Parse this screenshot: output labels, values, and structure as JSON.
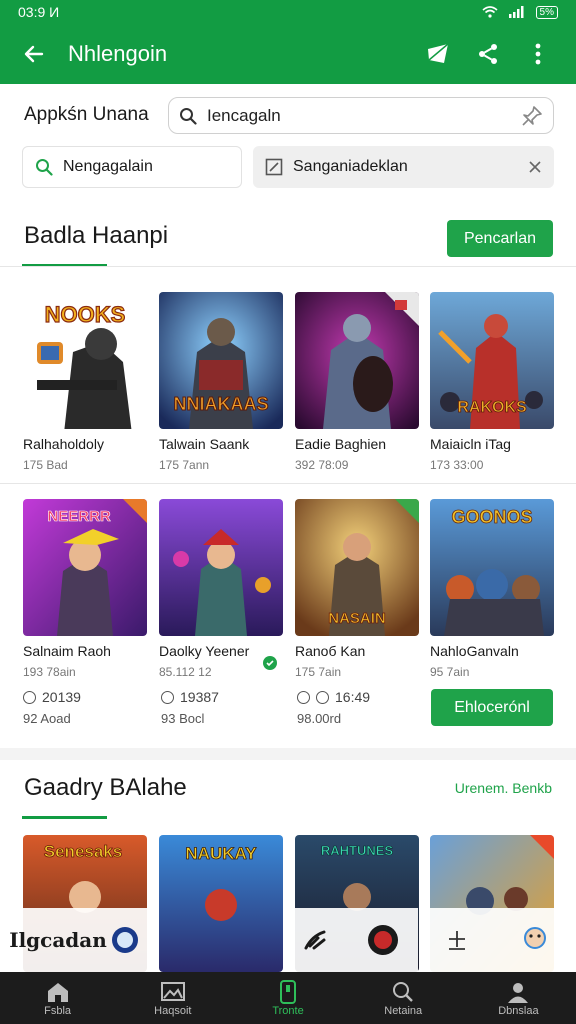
{
  "status_bar": {
    "time": "03:9 И",
    "battery": "5%"
  },
  "app_bar": {
    "title": "Nhlengoin",
    "back_icon": "arrow-left-icon",
    "actions": [
      "send-icon",
      "share-icon",
      "more-vert-icon"
    ]
  },
  "search": {
    "label": "Appkśn Unana",
    "value": "Iencagaln"
  },
  "filters": {
    "left_label": "Nengagalain",
    "right_label": "Sanganiadeklan"
  },
  "section1": {
    "title": "Badla Haanpi",
    "button": "Pencarlan",
    "row1": [
      {
        "name": "Ralhaholdoly",
        "meta": "175 Bad",
        "art": "NOOKS"
      },
      {
        "name": "Talwain Saank",
        "meta": "175 7ann",
        "art": "NNIAKAAS"
      },
      {
        "name": "Eadie Baghien",
        "meta": "392 78:09",
        "art": ""
      },
      {
        "name": "Maiaicln iTag",
        "meta": "173 33:00",
        "art": "RAKOKS"
      }
    ],
    "row2": [
      {
        "name": "Salnaim Raoh",
        "meta": "193 78ain",
        "art": "NEERRR",
        "stat": "20139",
        "stat2": "92 Aoad"
      },
      {
        "name": "Daolky Yeener",
        "meta": "85.112 12",
        "art": "",
        "stat": "19387",
        "stat2": "93 Bocl"
      },
      {
        "name": "Ranoб Kan",
        "meta": "175 7ain",
        "art": "NASAIN",
        "stat": "16:49",
        "stat2": "98.00rd"
      },
      {
        "name": "NahloGanvaln",
        "meta": "95 7ain",
        "art": "GOONOS"
      }
    ],
    "row2_button": "Ehlocerónl"
  },
  "section2": {
    "title": "Gaadry BAlahe",
    "link": "Urenem. Benkb",
    "row": [
      {
        "art": "Senesaks"
      },
      {
        "art": "NAUKAY"
      },
      {
        "art": "RAHTUNES"
      },
      {
        "art": ""
      }
    ],
    "overlay_text": "Ilgcadan"
  },
  "bottom_nav": [
    {
      "label": "Fsbla",
      "icon": "home-icon"
    },
    {
      "label": "Haqsoit",
      "icon": "image-icon"
    },
    {
      "label": "Tronte",
      "icon": "phone-icon",
      "active": true
    },
    {
      "label": "Netaina",
      "icon": "search-icon"
    },
    {
      "label": "Dbnslaa",
      "icon": "person-icon"
    }
  ],
  "colors": {
    "primary": "#129c43",
    "accent": "#1fa34a",
    "nav_bg": "#1c1c1c"
  }
}
